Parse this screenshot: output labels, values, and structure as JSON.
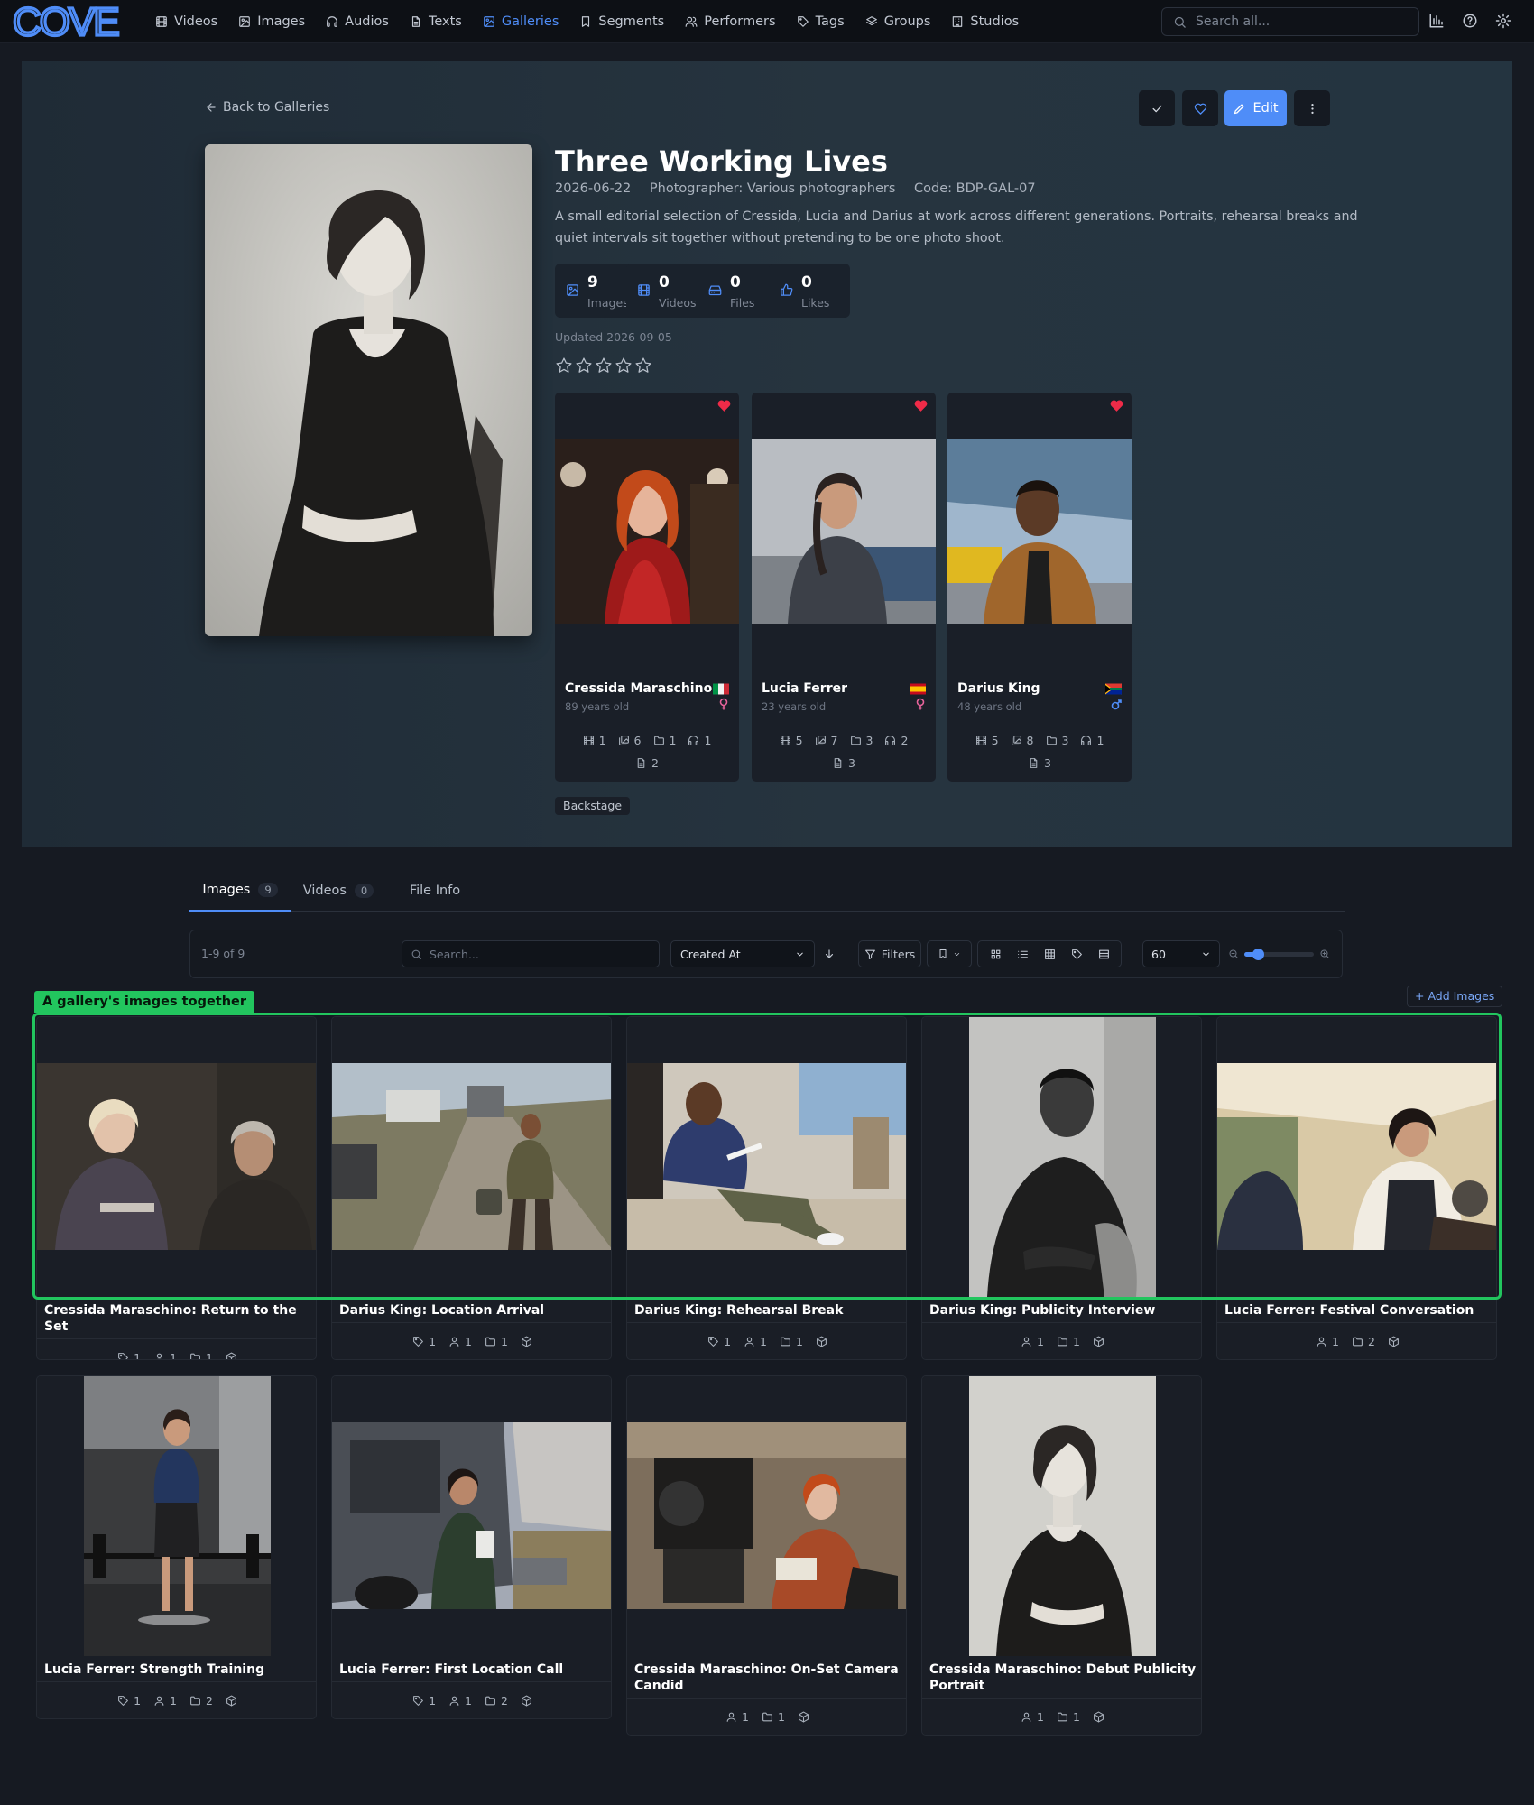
{
  "nav": {
    "logo": "COVE",
    "items": [
      {
        "label": "Videos",
        "icon": "film-icon"
      },
      {
        "label": "Images",
        "icon": "image-icon"
      },
      {
        "label": "Audios",
        "icon": "headphones-icon"
      },
      {
        "label": "Texts",
        "icon": "file-text-icon"
      },
      {
        "label": "Galleries",
        "icon": "gallery-icon",
        "active": true
      },
      {
        "label": "Segments",
        "icon": "bookmark-icon"
      },
      {
        "label": "Performers",
        "icon": "users-icon"
      },
      {
        "label": "Tags",
        "icon": "tag-icon"
      },
      {
        "label": "Groups",
        "icon": "layers-icon"
      },
      {
        "label": "Studios",
        "icon": "building-icon"
      }
    ],
    "search_placeholder": "Search all..."
  },
  "gallery": {
    "back_label": "Back to Galleries",
    "edit_label": "Edit",
    "title": "Three Working Lives",
    "date": "2026-06-22",
    "photographer": "Photographer: Various photographers",
    "code": "Code: BDP-GAL-07",
    "description": "A small editorial selection of Cressida, Lucia and Darius at work across different generations. Portraits, rehearsal breaks and quiet intervals sit together without pretending to be one photo shoot.",
    "stats": [
      {
        "value": "9",
        "label": "Images",
        "icon": "image-icon"
      },
      {
        "value": "0",
        "label": "Videos",
        "icon": "film-icon"
      },
      {
        "value": "0",
        "label": "Files",
        "icon": "hard-drive-icon"
      },
      {
        "value": "0",
        "label": "Likes",
        "icon": "thumbs-up-icon"
      }
    ],
    "updated": "Updated 2026-09-05",
    "rating": 0,
    "tag": "Backstage",
    "accent": "#4f8df8"
  },
  "performers": [
    {
      "name": "Cressida Maraschino",
      "age": "89 years old",
      "flag": "italy-flag",
      "gender": "female",
      "counts": [
        "1",
        "6",
        "1",
        "1"
      ],
      "texts": "2"
    },
    {
      "name": "Lucia Ferrer",
      "age": "23 years old",
      "flag": "spain-flag",
      "gender": "female",
      "counts": [
        "5",
        "7",
        "3",
        "2"
      ],
      "texts": "3"
    },
    {
      "name": "Darius King",
      "age": "48 years old",
      "flag": "south-africa-flag",
      "gender": "male",
      "counts": [
        "5",
        "8",
        "3",
        "1"
      ],
      "texts": "3"
    }
  ],
  "tabs": [
    {
      "label": "Images",
      "badge": "9"
    },
    {
      "label": "Videos",
      "badge": "0"
    },
    {
      "label": "File Info",
      "badge": ""
    }
  ],
  "toolbar": {
    "count": "1-9 of 9",
    "search_placeholder": "Search...",
    "sort": "Created At",
    "filters": "Filters",
    "per_page": "60"
  },
  "grid": {
    "label": "A gallery's images together",
    "add_label": "+ Add Images",
    "label_color": "#22c55e",
    "items": [
      {
        "title": "Cressida Maraschino: Return to the Set",
        "tags": "1",
        "performers": "1",
        "galleries": "1",
        "orient": "landscape"
      },
      {
        "title": "Darius King: Location Arrival",
        "tags": "1",
        "performers": "1",
        "galleries": "1",
        "orient": "landscape"
      },
      {
        "title": "Darius King: Rehearsal Break",
        "tags": "1",
        "performers": "1",
        "galleries": "1",
        "orient": "landscape"
      },
      {
        "title": "Darius King: Publicity Interview",
        "tags": "",
        "performers": "1",
        "galleries": "1",
        "orient": "portrait"
      },
      {
        "title": "Lucia Ferrer: Festival Conversation",
        "tags": "",
        "performers": "1",
        "galleries": "2",
        "orient": "landscape"
      },
      {
        "title": "Lucia Ferrer: Strength Training",
        "tags": "1",
        "performers": "1",
        "galleries": "2",
        "orient": "portrait"
      },
      {
        "title": "Lucia Ferrer: First Location Call",
        "tags": "1",
        "performers": "1",
        "galleries": "2",
        "orient": "landscape"
      },
      {
        "title": "Cressida Maraschino: On-Set Camera Candid",
        "tags": "",
        "performers": "1",
        "galleries": "1",
        "orient": "landscape"
      },
      {
        "title": "Cressida Maraschino: Debut Publicity Portrait",
        "tags": "",
        "performers": "1",
        "galleries": "1",
        "orient": "portrait"
      }
    ]
  }
}
